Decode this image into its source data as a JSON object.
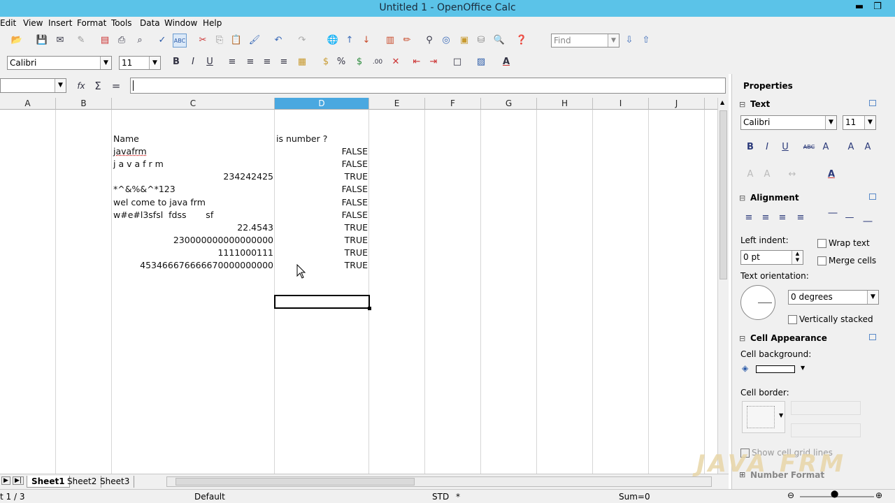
{
  "window": {
    "title": "Untitled 1 - OpenOffice Calc",
    "minimize_label": "▬",
    "restore_label": "❐"
  },
  "menu": [
    "Edit",
    "View",
    "Insert",
    "Format",
    "Tools",
    "Data",
    "Window",
    "Help"
  ],
  "toolbar": {
    "find_placeholder": "Find",
    "font_name": "Calibri",
    "font_size": "11"
  },
  "formula_bar": {
    "name_box": "",
    "functions_label": "fx",
    "sum_label": "Σ",
    "equals_label": "=",
    "content": ""
  },
  "sheet": {
    "columns": [
      "A",
      "B",
      "C",
      "D",
      "E",
      "F",
      "G",
      "H",
      "I",
      "J"
    ],
    "selected_column": "D",
    "rows": [
      {
        "c": "Name",
        "d": "is number ?"
      },
      {
        "c": "javafrm",
        "d": "FALSE"
      },
      {
        "c": "j a v a f r m",
        "d": "FALSE"
      },
      {
        "c": "234242425",
        "d": "TRUE"
      },
      {
        "c": "*^&%&^*123",
        "d": "FALSE"
      },
      {
        "c": "wel come to java frm",
        "d": "FALSE"
      },
      {
        "c": "w#e#l3sfsl  fdss       sf",
        "d": "FALSE"
      },
      {
        "c": "22.4543",
        "d": "TRUE"
      },
      {
        "c": "230000000000000000",
        "d": "TRUE"
      },
      {
        "c": "1111000111",
        "d": "TRUE"
      },
      {
        "c": "453466676666670000000000",
        "d": "TRUE"
      }
    ]
  },
  "tabs": {
    "sheets": [
      "Sheet1",
      "Sheet2",
      "Sheet3"
    ],
    "active": "Sheet1"
  },
  "status": {
    "sheet_info": "t 1 / 3",
    "page_style": "Default",
    "selection_mode": "STD",
    "modified": "*",
    "sum": "Sum=0"
  },
  "sidebar": {
    "title": "Properties",
    "text_section": "Text",
    "font_name": "Calibri",
    "font_size": "11",
    "alignment_section": "Alignment",
    "left_indent_label": "Left indent:",
    "left_indent_value": "0 pt",
    "wrap_text_label": "Wrap text",
    "merge_cells_label": "Merge cells",
    "text_orientation_label": "Text orientation:",
    "orientation_value": "0 degrees",
    "vertically_stacked_label": "Vertically stacked",
    "cell_appearance_section": "Cell Appearance",
    "cell_background_label": "Cell background:",
    "cell_border_label": "Cell border:",
    "show_grid_label": "Show cell grid lines",
    "number_format_section": "Number Format"
  },
  "watermark": "JAVA FRM"
}
